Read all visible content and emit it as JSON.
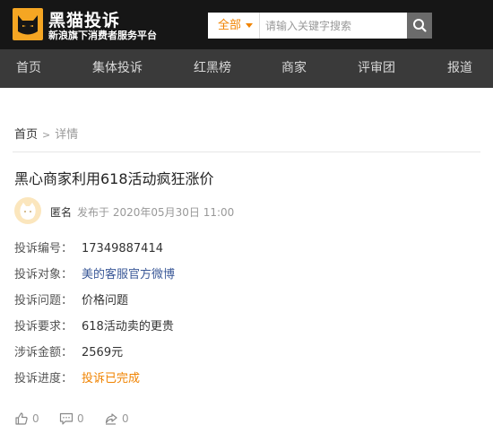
{
  "header": {
    "logo_title": "黑猫投诉",
    "logo_sub": "新浪旗下消费者服务平台",
    "search": {
      "category": "全部",
      "placeholder": "请输入关键字搜索",
      "value": ""
    }
  },
  "nav": {
    "items": [
      "首页",
      "集体投诉",
      "红黑榜",
      "商家",
      "评审团",
      "报道"
    ]
  },
  "breadcrumb": {
    "home": "首页",
    "sep": ">",
    "current": "详情"
  },
  "complaint": {
    "title": "黑心商家利用618活动疯狂涨价",
    "author": "匿名",
    "published": "发布于 2020年05月30日 11:00",
    "fields": [
      {
        "label": "投诉编号：",
        "value": "17349887414"
      },
      {
        "label": "投诉对象：",
        "value": "美的客服官方微博"
      },
      {
        "label": "投诉问题：",
        "value": "价格问题"
      },
      {
        "label": "投诉要求：",
        "value": "618活动卖的更贵"
      },
      {
        "label": "涉诉金额：",
        "value": "2569元"
      },
      {
        "label": "投诉进度：",
        "value": "投诉已完成"
      }
    ]
  },
  "actions": {
    "like_count": "0",
    "comment_count": "0",
    "share_count": "0"
  },
  "colors": {
    "accent": "#f08300",
    "link": "#3b5998",
    "header_bg": "#161616",
    "nav_bg": "#3a3a3a"
  },
  "icons": [
    "cat-logo-icon",
    "chevron-down-icon",
    "search-icon",
    "cat-avatar-icon",
    "thumbs-up-icon",
    "comment-icon",
    "share-icon"
  ]
}
